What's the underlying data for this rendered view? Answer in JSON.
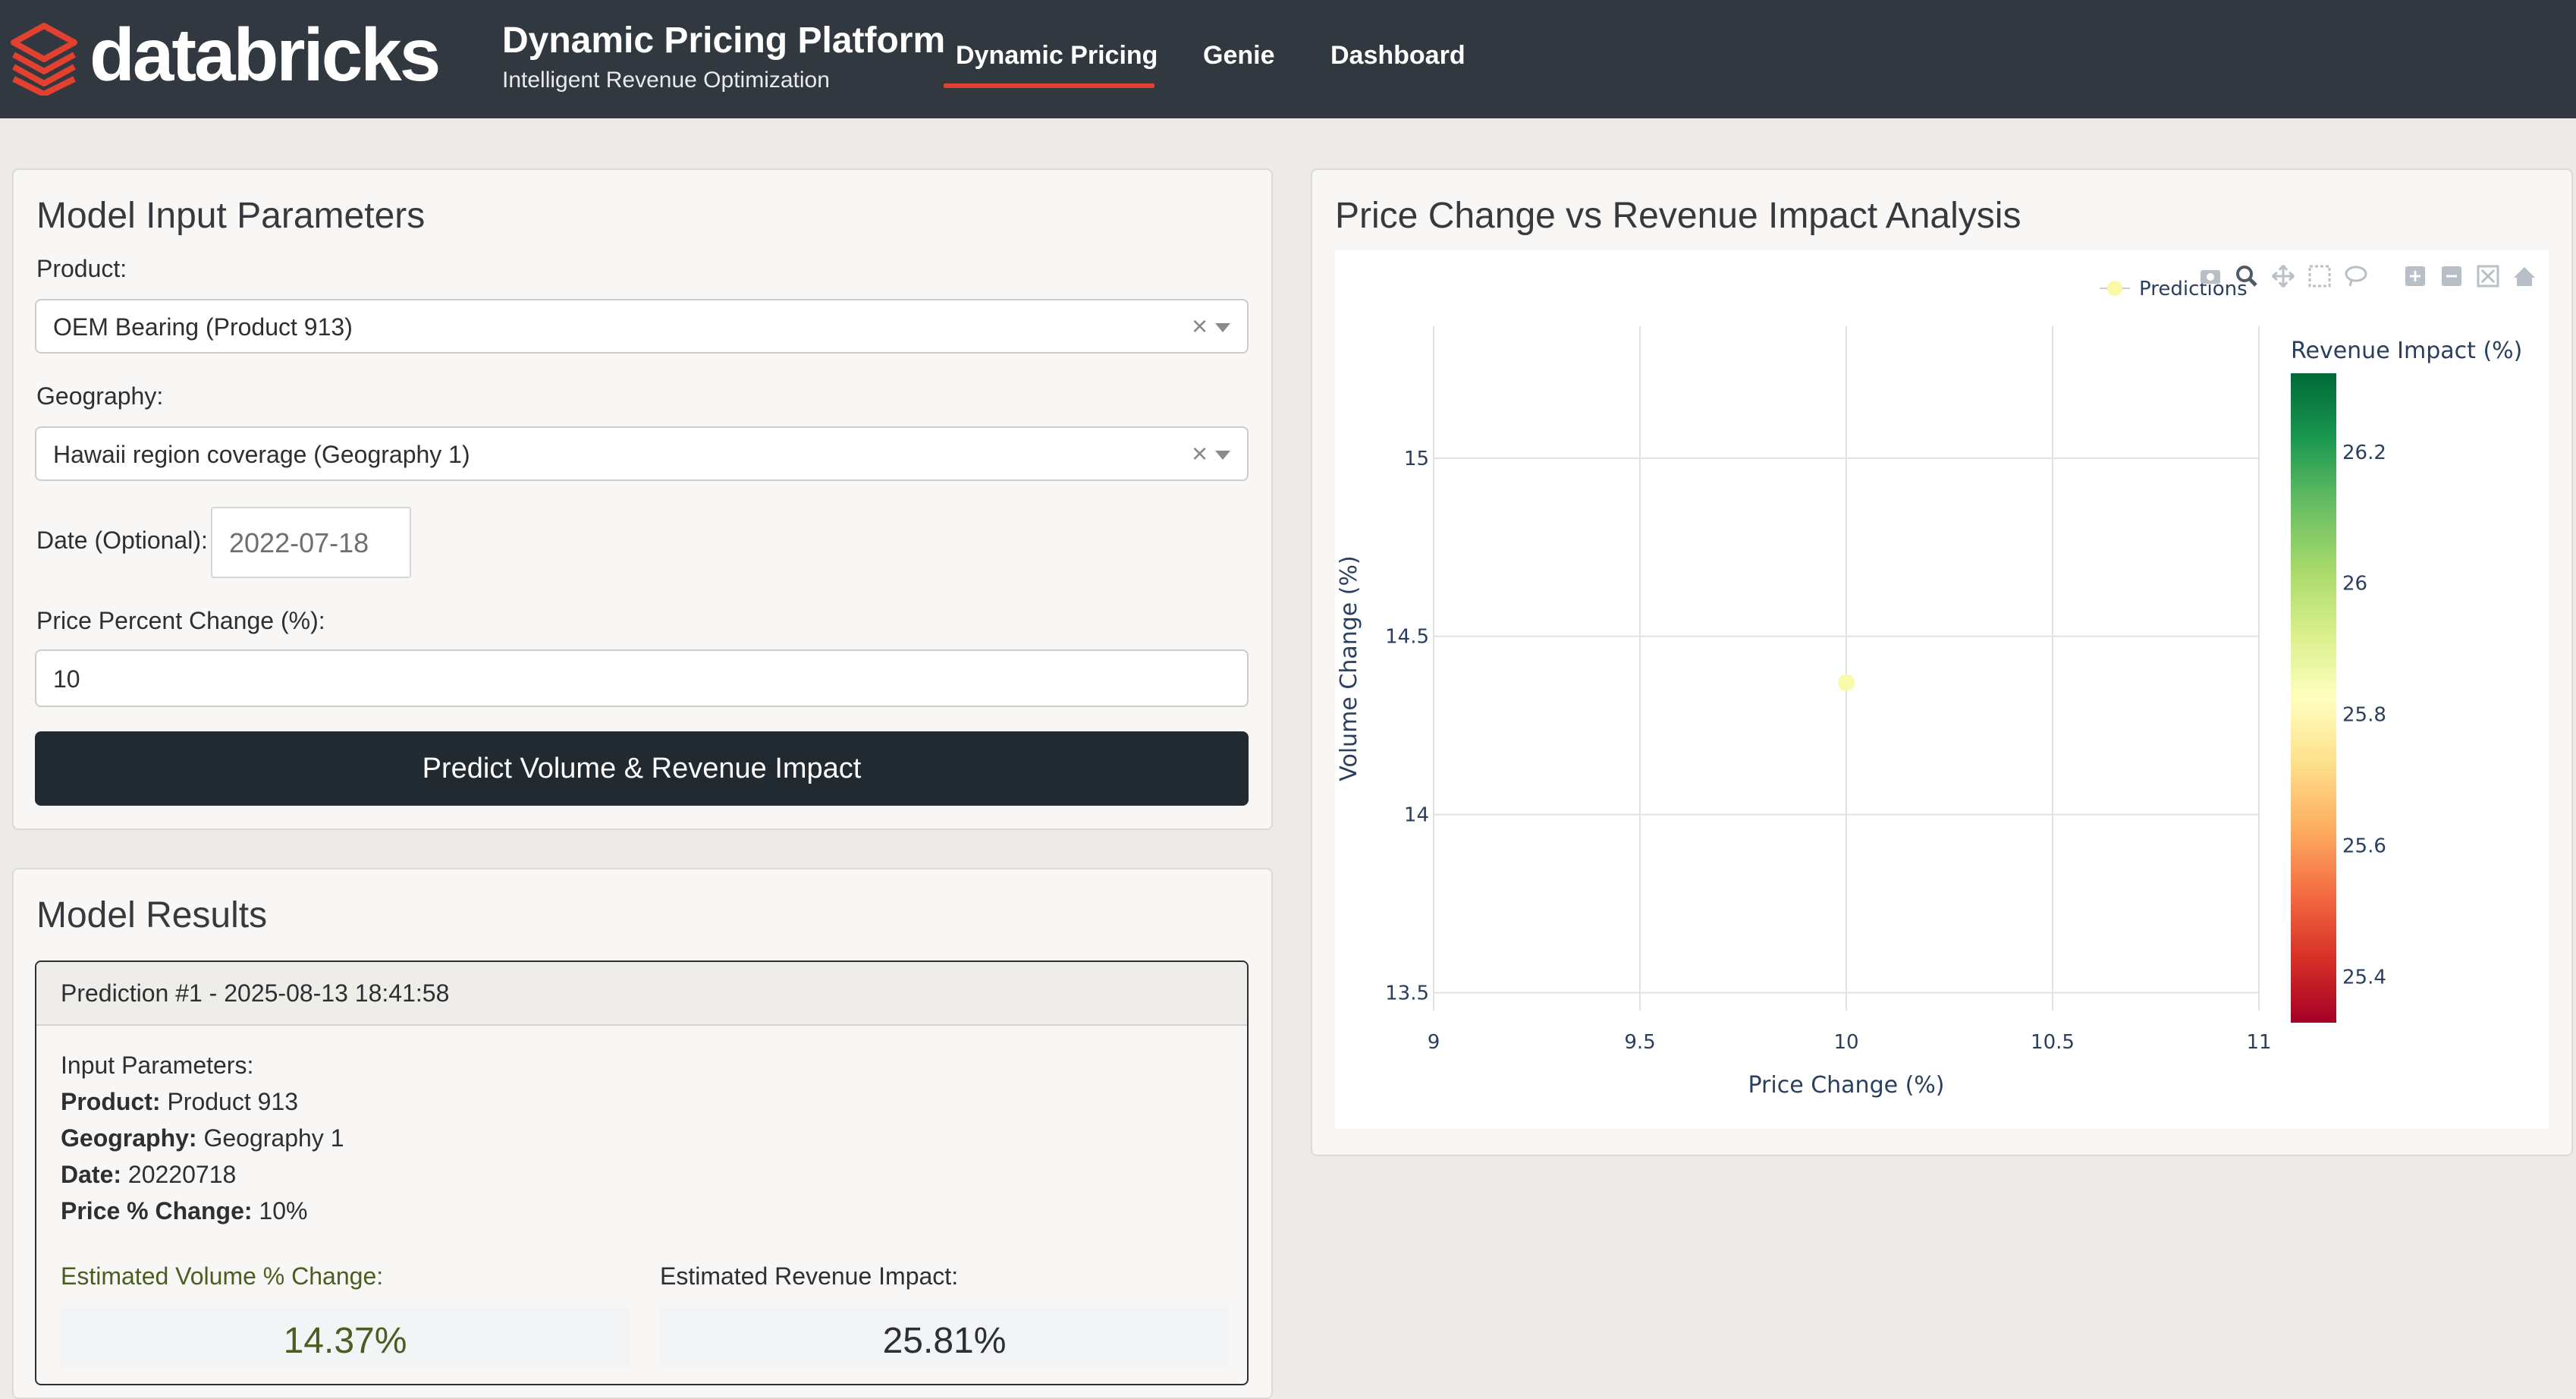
{
  "navbar": {
    "logo_text": "databricks",
    "app_title": "Dynamic Pricing Platform",
    "app_subtitle": "Intelligent Revenue Optimization",
    "tabs": [
      {
        "label": "Dynamic Pricing",
        "active": true
      },
      {
        "label": "Genie",
        "active": false
      },
      {
        "label": "Dashboard",
        "active": false
      }
    ],
    "accent_color": "#e2412f",
    "background_color": "#313840"
  },
  "inputs": {
    "title": "Model Input Parameters",
    "product_label": "Product:",
    "product_value": "OEM Bearing (Product 913)",
    "geography_label": "Geography:",
    "geography_value": "Hawaii region coverage (Geography 1)",
    "date_label": "Date (Optional):",
    "date_value": "2022-07-18",
    "price_change_label": "Price Percent Change (%):",
    "price_change_value": "10",
    "clear_glyph": "×",
    "predict_button": "Predict Volume & Revenue Impact"
  },
  "results": {
    "title": "Model Results",
    "prediction_header": "Prediction #1 - 2025-08-13 18:41:58",
    "input_params_label": "Input Parameters:",
    "product_key": "Product:",
    "product_val": "Product 913",
    "geography_key": "Geography:",
    "geography_val": "Geography 1",
    "date_key": "Date:",
    "date_val": "20220718",
    "price_key": "Price % Change:",
    "price_val": "10%",
    "volume_label": "Estimated Volume % Change:",
    "volume_value": "14.37%",
    "revenue_label": "Estimated Revenue Impact:",
    "revenue_value": "25.81%",
    "volume_color": "#4b5e22"
  },
  "chart_panel": {
    "title": "Price Change vs Revenue Impact Analysis",
    "toolbar_icons": [
      "camera-icon",
      "zoom-icon",
      "pan-icon",
      "box-select-icon",
      "lasso-select-icon",
      "zoom-in-icon",
      "zoom-out-icon",
      "autoscale-icon",
      "reset-axes-icon"
    ]
  },
  "chart_data": {
    "type": "scatter",
    "xlabel": "Price Change (%)",
    "ylabel": "Volume Change (%)",
    "xlim": [
      9,
      11
    ],
    "ylim": [
      13.45,
      15.37
    ],
    "xticks": [
      9,
      9.5,
      10,
      10.5,
      11
    ],
    "yticks": [
      13.5,
      14,
      14.5,
      15
    ],
    "xtick_labels": [
      "9",
      "9.5",
      "10",
      "10.5",
      "11"
    ],
    "ytick_labels": [
      "13.5",
      "14",
      "14.5",
      "15"
    ],
    "grid": true,
    "legend": {
      "position": "top-right",
      "entries": [
        "Predictions"
      ]
    },
    "series": [
      {
        "name": "Predictions",
        "points": [
          {
            "x": 10,
            "y": 14.37,
            "revenue_impact": 25.81
          }
        ],
        "color": "#fbf9a8"
      }
    ],
    "colorbar": {
      "title": "Revenue Impact (%)",
      "range": [
        25.33,
        26.32
      ],
      "ticks": [
        25.4,
        25.6,
        25.8,
        26,
        26.2
      ],
      "tick_labels": [
        "25.4",
        "25.6",
        "25.8",
        "26",
        "26.2"
      ],
      "colorscale": [
        "#a50026",
        "#d73027",
        "#f46d43",
        "#fdae61",
        "#fee08b",
        "#ffffbf",
        "#d9ef8b",
        "#a6d96a",
        "#66bd63",
        "#1a9850",
        "#006837"
      ]
    }
  }
}
